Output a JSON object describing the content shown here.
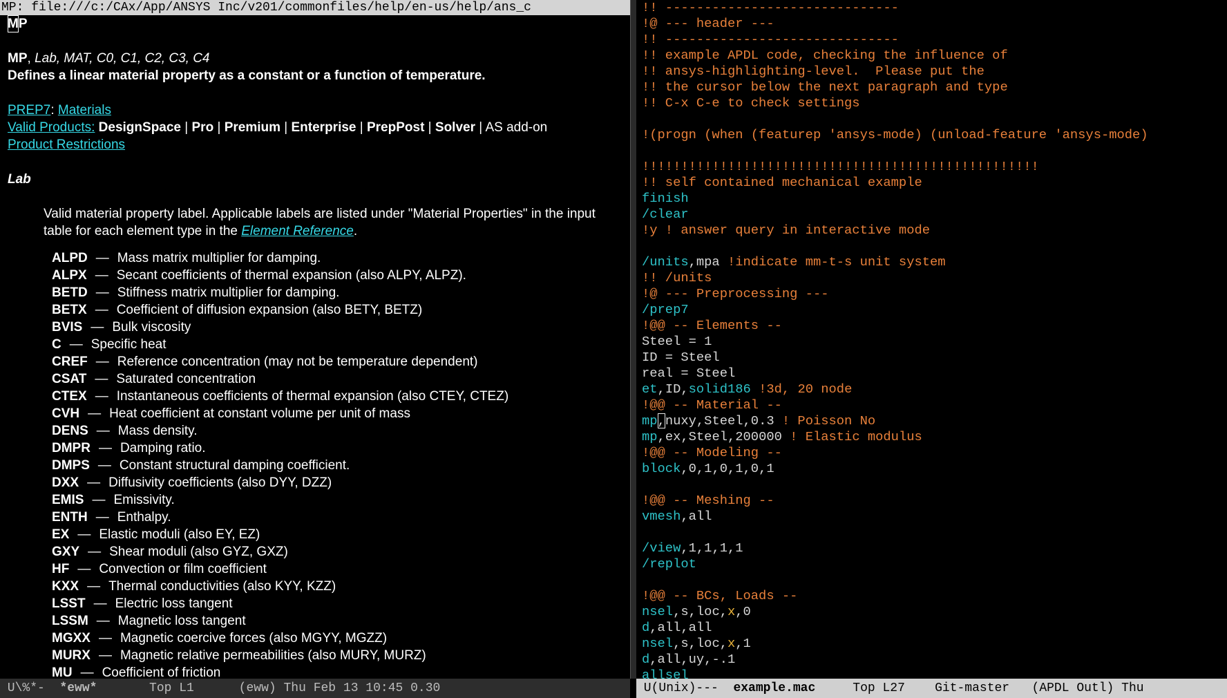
{
  "left": {
    "url_line": "MP: file:///c:/CAx/App/ANSYS Inc/v201/commonfiles/help/en-us/help/ans_c",
    "title": "MP",
    "signature": {
      "cmd": "MP",
      "args": "Lab, MAT, C0, C1, C2, C3, C4"
    },
    "summary": "Defines a linear material property as a constant or a function of temperature.",
    "prep7": "PREP7",
    "materials": "Materials",
    "valid_products_label": "Valid Products:",
    "products": [
      "DesignSpace",
      "Pro",
      "Premium",
      "Enterprise",
      "PrepPost",
      "Solver"
    ],
    "addon": "AS add-on",
    "product_restrictions": "Product Restrictions",
    "lab_heading": "Lab",
    "lab_desc_1": "Valid material property label. Applicable labels are listed under \"Material Properties\" in the input table for each element type in the ",
    "element_reference": "Element Reference",
    "lab_desc_end": ".",
    "labels": [
      {
        "code": "ALPD",
        "desc": "Mass matrix multiplier for damping."
      },
      {
        "code": "ALPX",
        "desc": "Secant coefficients of thermal expansion (also ALPY, ALPZ)."
      },
      {
        "code": "BETD",
        "desc": "Stiffness matrix multiplier for damping."
      },
      {
        "code": "BETX",
        "desc": "Coefficient of diffusion expansion (also BETY, BETZ)"
      },
      {
        "code": "BVIS",
        "desc": "Bulk viscosity"
      },
      {
        "code": "C",
        "desc": "Specific heat"
      },
      {
        "code": "CREF",
        "desc": "Reference concentration (may not be temperature dependent)"
      },
      {
        "code": "CSAT",
        "desc": "Saturated concentration"
      },
      {
        "code": "CTEX",
        "desc": "Instantaneous coefficients of thermal expansion (also CTEY, CTEZ)"
      },
      {
        "code": "CVH",
        "desc": "Heat coefficient at constant volume per unit of mass"
      },
      {
        "code": "DENS",
        "desc": "Mass density."
      },
      {
        "code": "DMPR",
        "desc": "Damping ratio."
      },
      {
        "code": "DMPS",
        "desc": "Constant structural damping coefficient."
      },
      {
        "code": "DXX",
        "desc": "Diffusivity coefficients (also DYY, DZZ)"
      },
      {
        "code": "EMIS",
        "desc": "Emissivity."
      },
      {
        "code": "ENTH",
        "desc": "Enthalpy."
      },
      {
        "code": "EX",
        "desc": "Elastic moduli (also EY, EZ)"
      },
      {
        "code": "GXY",
        "desc": "Shear moduli (also GYZ, GXZ)"
      },
      {
        "code": "HF",
        "desc": "Convection or film coefficient"
      },
      {
        "code": "KXX",
        "desc": "Thermal conductivities (also KYY, KZZ)"
      },
      {
        "code": "LSST",
        "desc": "Electric loss tangent"
      },
      {
        "code": "LSSM",
        "desc": "Magnetic loss tangent"
      },
      {
        "code": "MGXX",
        "desc": "Magnetic coercive forces (also MGYY, MGZZ)"
      },
      {
        "code": "MURX",
        "desc": "Magnetic relative permeabilities (also MURY, MURZ)"
      },
      {
        "code": "MU",
        "desc": "Coefficient of friction"
      }
    ],
    "dash": "—"
  },
  "code_lines": [
    [
      [
        "cm",
        "!! ------------------------------"
      ]
    ],
    [
      [
        "cm",
        "!@ --- header ---"
      ]
    ],
    [
      [
        "cm",
        "!! ------------------------------"
      ]
    ],
    [
      [
        "cm",
        "!! example APDL code, checking the influence of"
      ]
    ],
    [
      [
        "cm",
        "!! ansys-highlighting-level.  Please put the"
      ]
    ],
    [
      [
        "cm",
        "!! the cursor below the next paragraph and type"
      ]
    ],
    [
      [
        "cm",
        "!! C-x C-e to check settings"
      ]
    ],
    [
      [
        "tx",
        ""
      ]
    ],
    [
      [
        "cm",
        "!(progn (when (featurep 'ansys-mode) (unload-feature 'ansys-mode)"
      ]
    ],
    [
      [
        "tx",
        ""
      ]
    ],
    [
      [
        "cm",
        "!!!!!!!!!!!!!!!!!!!!!!!!!!!!!!!!!!!!!!!!!!!!!!!!!!!"
      ]
    ],
    [
      [
        "cm",
        "!! self contained mechanical example"
      ]
    ],
    [
      [
        "kw",
        "finish"
      ]
    ],
    [
      [
        "kw",
        "/clear"
      ]
    ],
    [
      [
        "cm",
        "!y ! answer query in interactive mode"
      ]
    ],
    [
      [
        "tx",
        ""
      ]
    ],
    [
      [
        "kw",
        "/units"
      ],
      [
        "tx",
        ",mpa "
      ],
      [
        "cm",
        "!indicate mm-t-s unit system"
      ]
    ],
    [
      [
        "cm",
        "!! /units"
      ]
    ],
    [
      [
        "cm",
        "!@ --- Preprocessing ---"
      ]
    ],
    [
      [
        "kw",
        "/prep7"
      ]
    ],
    [
      [
        "cm",
        "!@@ -- Elements --"
      ]
    ],
    [
      [
        "tx",
        "Steel = 1"
      ]
    ],
    [
      [
        "tx",
        "ID = Steel"
      ]
    ],
    [
      [
        "tx",
        "real = Steel"
      ]
    ],
    [
      [
        "kw",
        "et"
      ],
      [
        "tx",
        ",ID,"
      ],
      [
        "kw",
        "solid186"
      ],
      [
        "tx",
        " "
      ],
      [
        "cm",
        "!3d, 20 node"
      ]
    ],
    [
      [
        "cm",
        "!@@ -- Material --"
      ]
    ],
    [
      [
        "kw",
        "mp"
      ],
      [
        "cur",
        ","
      ],
      [
        "tx",
        "nuxy,Steel,0.3 "
      ],
      [
        "cm",
        "! Poisson No"
      ]
    ],
    [
      [
        "kw",
        "mp"
      ],
      [
        "tx",
        ",ex,Steel,200000 "
      ],
      [
        "cm",
        "! Elastic modulus"
      ]
    ],
    [
      [
        "cm",
        "!@@ -- Modeling --"
      ]
    ],
    [
      [
        "kw",
        "block"
      ],
      [
        "tx",
        ",0,1,0,1,0,1"
      ]
    ],
    [
      [
        "tx",
        ""
      ]
    ],
    [
      [
        "cm",
        "!@@ -- Meshing --"
      ]
    ],
    [
      [
        "kw",
        "vmesh"
      ],
      [
        "tx",
        ",all"
      ]
    ],
    [
      [
        "tx",
        ""
      ]
    ],
    [
      [
        "kw",
        "/view"
      ],
      [
        "tx",
        ",1,1,1,1"
      ]
    ],
    [
      [
        "kw",
        "/replot"
      ]
    ],
    [
      [
        "tx",
        ""
      ]
    ],
    [
      [
        "cm",
        "!@@ -- BCs, Loads --"
      ]
    ],
    [
      [
        "kw",
        "nsel"
      ],
      [
        "tx",
        ",s,loc,"
      ],
      [
        "vr",
        "x"
      ],
      [
        "tx",
        ",0"
      ]
    ],
    [
      [
        "kw",
        "d"
      ],
      [
        "tx",
        ",all,all"
      ]
    ],
    [
      [
        "kw",
        "nsel"
      ],
      [
        "tx",
        ",s,loc,"
      ],
      [
        "vr",
        "x"
      ],
      [
        "tx",
        ",1"
      ]
    ],
    [
      [
        "kw",
        "d"
      ],
      [
        "tx",
        ",all,uy,-.1"
      ]
    ],
    [
      [
        "kw",
        "allsel"
      ]
    ]
  ],
  "modeline_left": {
    "status": " U\\%*-  ",
    "buffer": "*eww*",
    "rest": "       Top L1      (eww) Thu Feb 13 10:45 0.30"
  },
  "modeline_right": {
    "status": " U(Unix)---  ",
    "buffer": "example.mac",
    "rest": "     Top L27    Git-master   (APDL Outl) Thu"
  }
}
